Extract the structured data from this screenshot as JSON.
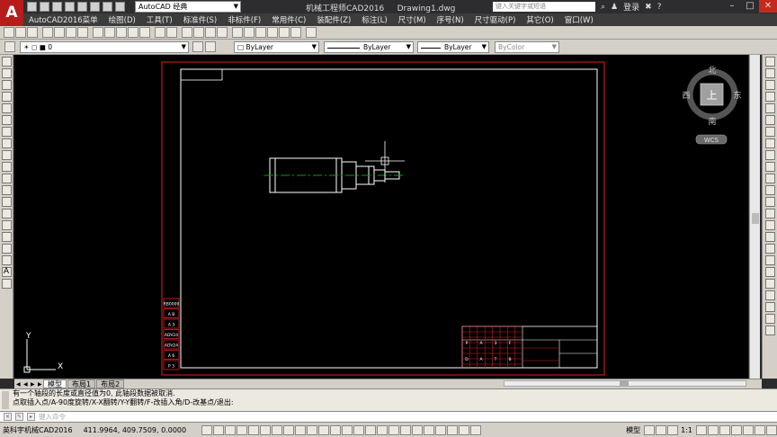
{
  "title": {
    "workspace": "AutoCAD 经典",
    "app_title": "机械工程师CAD2016",
    "document": "Drawing1.dwg",
    "search_placeholder": "键入关键字或短语",
    "login": "登录",
    "help": "?"
  },
  "menu": [
    "AutoCAD2016菜单",
    "绘图(D)",
    "工具(T)",
    "标准件(S)",
    "非标件(F)",
    "常用件(C)",
    "装配件(Z)",
    "标注(L)",
    "尺寸(M)",
    "序号(N)",
    "尺寸驱动(P)",
    "其它(O)",
    "窗口(W)"
  ],
  "properties": {
    "layer_value": "0",
    "color_value": "ByLayer",
    "linetype_value": "ByLayer",
    "lineweight_value": "ByLayer",
    "plotstyle_value": "ByColor"
  },
  "viewcube": {
    "north": "北",
    "south": "南",
    "east": "东",
    "west": "西",
    "top": "上",
    "wcs": "WCS"
  },
  "ucs": {
    "x": "X",
    "y": "Y"
  },
  "left_labels": [
    "RB0009",
    "A B",
    "A 3",
    "ADV24",
    "ADV24",
    "A 6",
    "P 3"
  ],
  "title_block_cells": [
    "P",
    "A",
    "3",
    "F",
    "D",
    "A",
    "T",
    "B"
  ],
  "layout_tabs": {
    "model": "模型",
    "layout1": "布局1",
    "layout2": "布局2"
  },
  "command": {
    "line1": "有一个轴段的长度或直径值为0, 此轴段数据被取消.",
    "line2": "点取插入点/A-90度旋转/X-X翻转/Y-Y翻转/F-改插入角/D-改基点/退出:",
    "placeholder": "键入命令"
  },
  "status": {
    "app_name": "英科宇机械CAD2016",
    "coordinates": "411.9964, 409.7509, 0.0000",
    "model": "模型",
    "scale": "1:1"
  },
  "colors": {
    "canvas": "#000000",
    "frame_red": "#e02020",
    "centerline": "#00a000",
    "geometry": "#ffffff",
    "logo": "#b61c1c"
  }
}
